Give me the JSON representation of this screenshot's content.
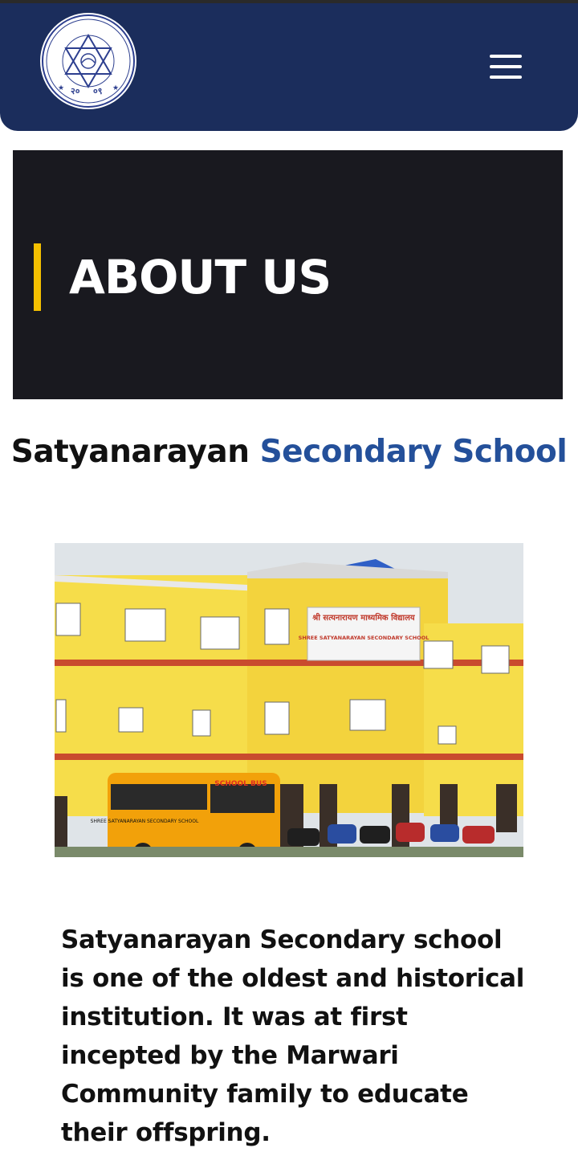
{
  "header": {
    "logo": {
      "alt_name": "school-logo",
      "devanagari_top": "श्री सत्यनारायण माध्यमिक विद्यालय",
      "year_left": "२०",
      "year_right": "०९",
      "devanagari_bottom": "विराटनगर"
    },
    "menu_icon": "hamburger-icon"
  },
  "banner": {
    "title": "ABOUT US",
    "accent_color": "#f5c000",
    "background": "#19191f"
  },
  "school": {
    "name_first": "Satyanarayan",
    "name_accent": "Secondary School",
    "accent_color": "#24509a"
  },
  "photo": {
    "sign_devanagari": "श्री सत्यनारायण माध्यमिक विद्यालय",
    "sign_english": "SHREE SATYANARAYAN SECONDARY SCHOOL",
    "bus_front_label": "SCHOOL BUS",
    "bus_side_label": "SHREE SATYANARAYAN SECONDARY SCHOOL"
  },
  "about": {
    "paragraph": "Satyanarayan Secondary school is one of the oldest and historical institution. It was at first incepted by the Marwari Community family to educate their offspring."
  },
  "colors": {
    "header_bg": "#1b2d5c",
    "page_bg": "#ffffff"
  }
}
